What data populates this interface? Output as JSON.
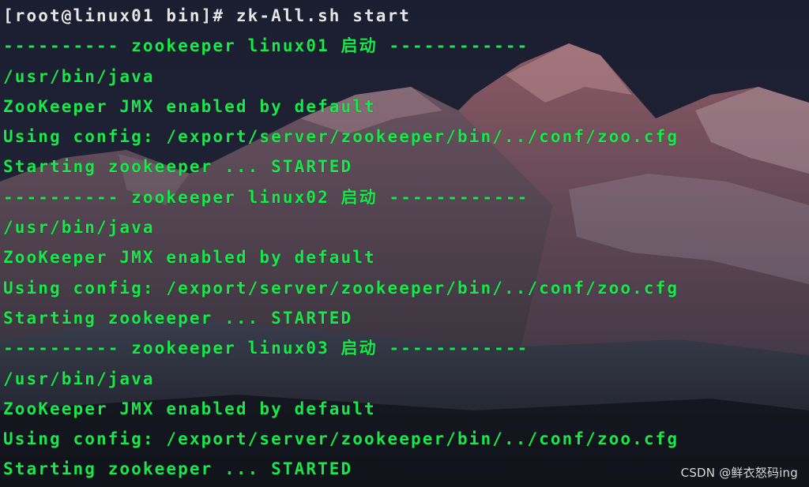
{
  "terminal": {
    "lines": [
      {
        "kind": "prompt",
        "text": "[root@linux01 bin]# zk-All.sh start"
      },
      {
        "kind": "output",
        "text": "---------- zookeeper linux01 启动 ------------"
      },
      {
        "kind": "output",
        "text": "/usr/bin/java"
      },
      {
        "kind": "output",
        "text": "ZooKeeper JMX enabled by default"
      },
      {
        "kind": "output",
        "text": "Using config: /export/server/zookeeper/bin/../conf/zoo.cfg"
      },
      {
        "kind": "output",
        "text": "Starting zookeeper ... STARTED"
      },
      {
        "kind": "output",
        "text": "---------- zookeeper linux02 启动 ------------"
      },
      {
        "kind": "output",
        "text": "/usr/bin/java"
      },
      {
        "kind": "output",
        "text": "ZooKeeper JMX enabled by default"
      },
      {
        "kind": "output",
        "text": "Using config: /export/server/zookeeper/bin/../conf/zoo.cfg"
      },
      {
        "kind": "output",
        "text": "Starting zookeeper ... STARTED"
      },
      {
        "kind": "output",
        "text": "---------- zookeeper linux03 启动 ------------"
      },
      {
        "kind": "output",
        "text": "/usr/bin/java"
      },
      {
        "kind": "output",
        "text": "ZooKeeper JMX enabled by default"
      },
      {
        "kind": "output",
        "text": "Using config: /export/server/zookeeper/bin/../conf/zoo.cfg"
      },
      {
        "kind": "output",
        "text": "Starting zookeeper ... STARTED"
      }
    ],
    "colors": {
      "prompt_text": "#e6e6e6",
      "output_text": "#18e84a",
      "background": "#1a1d30"
    },
    "background_icon": "mountain-wallpaper"
  },
  "watermark": {
    "text": "CSDN @鲜衣怒码ing"
  }
}
